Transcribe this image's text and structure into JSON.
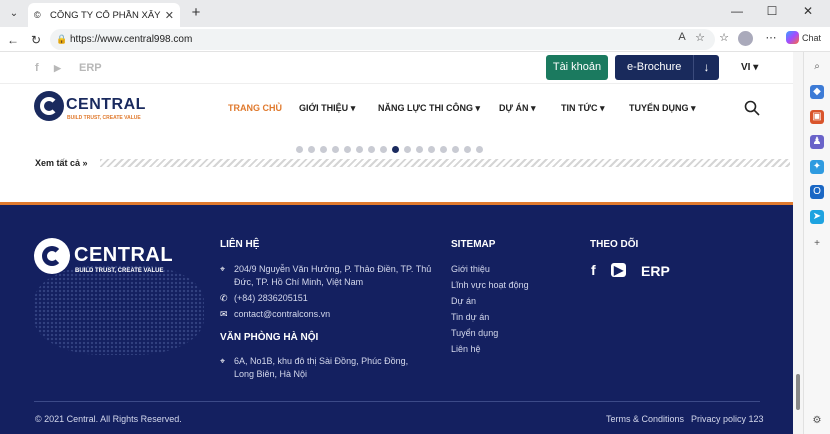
{
  "browser": {
    "tab_title": "CÔNG TY CỔ PHẦN XÂY DỰNG CE",
    "url": "https://www.central998.com",
    "chat_label": "Chat"
  },
  "topbar": {
    "erp": "ERP",
    "account_button": "Tài khoản",
    "brochure_button": "e-Brochure",
    "lang": "VI"
  },
  "header": {
    "logo_word": "CENTRAL",
    "logo_tagline": "BUILD TRUST, CREATE VALUE",
    "menu": [
      {
        "label": "TRANG CHỦ"
      },
      {
        "label": "GIỚI THIỆU"
      },
      {
        "label": "NĂNG LỰC THI CÔNG"
      },
      {
        "label": "DỰ ÁN"
      },
      {
        "label": "TIN TỨC"
      },
      {
        "label": "TUYỂN DỤNG"
      }
    ]
  },
  "carousel": {
    "total": 16,
    "active_index": 8,
    "see_all": "Xem tất cả »"
  },
  "footer": {
    "logo_word": "CENTRAL",
    "logo_tagline": "BUILD TRUST, CREATE VALUE",
    "contact": {
      "heading": "LIÊN HỆ",
      "address": "204/9 Nguyễn Văn Hưởng, P. Thảo Điền, TP. Thủ Đức, TP. Hồ Chí Minh, Việt Nam",
      "phone": "(+84) 2836205151",
      "email": "contact@contralcons.vn"
    },
    "hanoi": {
      "heading": "VĂN PHÒNG HÀ NỘI",
      "address": "6A, No1B, khu đô thị Sài Đồng, Phúc Đồng, Long Biên, Hà Nội"
    },
    "sitemap": {
      "heading": "SITEMAP",
      "links": [
        "Giới thiệu",
        "Lĩnh vực hoạt động",
        "Dự án",
        "Tin dự án",
        "Tuyển dụng",
        "Liên hệ"
      ]
    },
    "follow": {
      "heading": "THEO DÕI",
      "erp": "ERP"
    },
    "copyright": "© 2021 Central. All Rights Reserved.",
    "terms": "Terms & Conditions",
    "privacy": "Privacy policy 123"
  },
  "colors": {
    "navy": "#142060",
    "orange": "#e07a2e",
    "green": "#1b7a5f"
  }
}
